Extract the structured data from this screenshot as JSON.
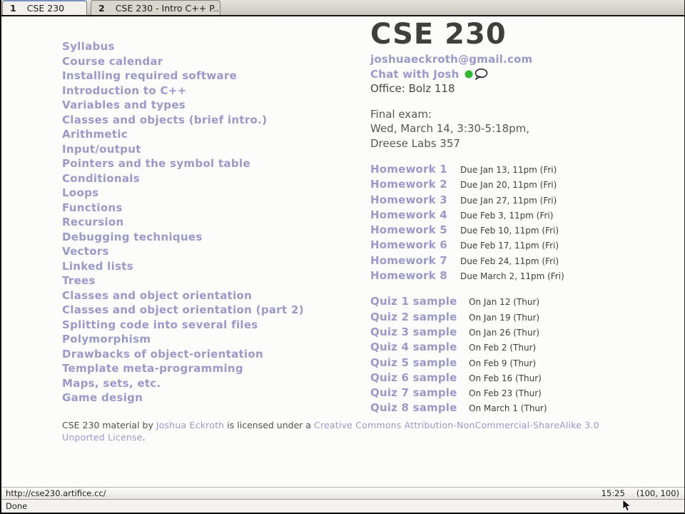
{
  "tabs": [
    {
      "number": "1",
      "title": "CSE 230",
      "active": true
    },
    {
      "number": "2",
      "title": "CSE 230 - Intro C++ P...",
      "active": false
    }
  ],
  "sidebar": {
    "links": [
      "Syllabus",
      "Course calendar",
      "Installing required software",
      "Introduction to C++",
      "Variables and types",
      "Classes and objects (brief intro.)",
      "Arithmetic",
      "Input/output",
      "Pointers and the symbol table",
      "Conditionals",
      "Loops",
      "Functions",
      "Recursion",
      "Debugging techniques",
      "Vectors",
      "Linked lists",
      "Trees",
      "Classes and object orientation",
      "Classes and object orientation (part 2)",
      "Splitting code into several files",
      "Polymorphism",
      "Drawbacks of object-orientation",
      "Template meta-programming",
      "Maps, sets, etc.",
      "Game design"
    ]
  },
  "main": {
    "title": "CSE 230",
    "email": "joshuaeckroth@gmail.com",
    "chat_label": "Chat with Josh",
    "chat_status_icon": "green-presence-dot",
    "chat_bubble_icon": "speech-bubble",
    "office": "Office: Bolz 118",
    "final_exam": {
      "heading": "Final exam:",
      "time": "Wed, March 14, 3:30-5:18pm,",
      "location": "Dreese Labs 357"
    },
    "homework": [
      {
        "label": "Homework 1",
        "due": "Due Jan 13, 11pm (Fri)"
      },
      {
        "label": "Homework 2",
        "due": "Due Jan 20, 11pm (Fri)"
      },
      {
        "label": "Homework 3",
        "due": "Due Jan 27, 11pm (Fri)"
      },
      {
        "label": "Homework 4",
        "due": "Due Feb 3, 11pm (Fri)"
      },
      {
        "label": "Homework 5",
        "due": "Due Feb 10, 11pm (Fri)"
      },
      {
        "label": "Homework 6",
        "due": "Due Feb 17, 11pm (Fri)"
      },
      {
        "label": "Homework 7",
        "due": "Due Feb 24, 11pm (Fri)"
      },
      {
        "label": "Homework 8",
        "due": "Due March 2, 11pm (Fri)"
      }
    ],
    "quizzes": [
      {
        "label": "Quiz 1 sample",
        "date": "On Jan 12 (Thur)"
      },
      {
        "label": "Quiz 2 sample",
        "date": "On Jan 19 (Thur)"
      },
      {
        "label": "Quiz 3 sample",
        "date": "On Jan 26 (Thur)"
      },
      {
        "label": "Quiz 4 sample",
        "date": "On Feb 2 (Thur)"
      },
      {
        "label": "Quiz 5 sample",
        "date": "On Feb 9 (Thur)"
      },
      {
        "label": "Quiz 6 sample",
        "date": "On Feb 16 (Thur)"
      },
      {
        "label": "Quiz 7 sample",
        "date": "On Feb 23 (Thur)"
      },
      {
        "label": "Quiz 8 sample",
        "date": "On March 1 (Thur)"
      }
    ],
    "license": {
      "prefix": "CSE 230 material by ",
      "author_link": "Joshua Eckroth",
      "middle": " is licensed under a ",
      "license_link": "Creative Commons Attribution-NonCommercial-ShareAlike 3.0 Unported License",
      "suffix": "."
    }
  },
  "statusbar": {
    "url": "http://cse230.artifice.cc/",
    "time": "15:25",
    "coords": "(100, 100)",
    "status": "Done"
  },
  "colors": {
    "link_purple": "#9b98cb",
    "text_dark": "#3f3f3f",
    "presence_green": "#2eb82e",
    "tab_active_bg": "#f2f0ea",
    "tab_inactive_bg": "#d9d6ce"
  }
}
